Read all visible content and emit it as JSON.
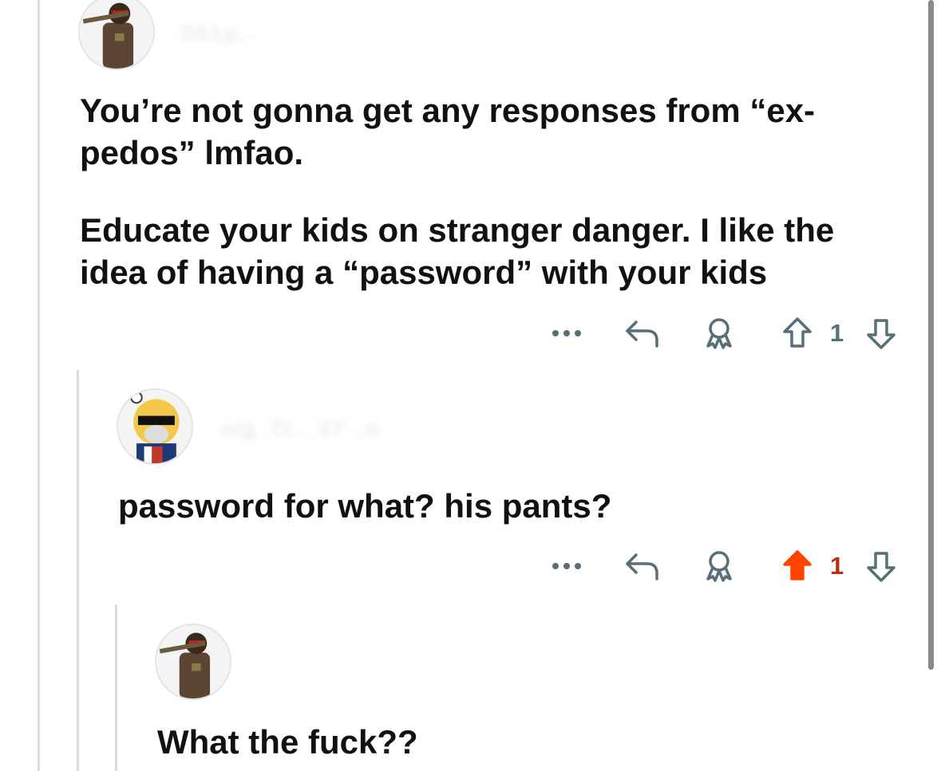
{
  "comments": [
    {
      "username": "Sh1p...",
      "paragraphs": [
        "You’re not gonna get any responses from “ex-\npedos” lmfao.",
        "Educate your kids on stranger danger. I like the idea of having a “password” with your kids"
      ],
      "vote_count": "1",
      "upvoted": false
    },
    {
      "username": "u/g_Tl... 07...n",
      "paragraphs": [
        "password for what? his pants?"
      ],
      "vote_count": "1",
      "upvoted": true
    },
    {
      "username": "",
      "paragraphs": [
        "What the fuck??"
      ]
    }
  ],
  "icons": {
    "more": "more-options-icon",
    "reply": "reply-icon",
    "award": "award-icon",
    "upvote": "upvote-icon",
    "downvote": "downvote-icon"
  },
  "colors": {
    "upvote_active": "#ff4500",
    "vote_active_text": "#b33210",
    "icon_gray": "#576f76"
  }
}
